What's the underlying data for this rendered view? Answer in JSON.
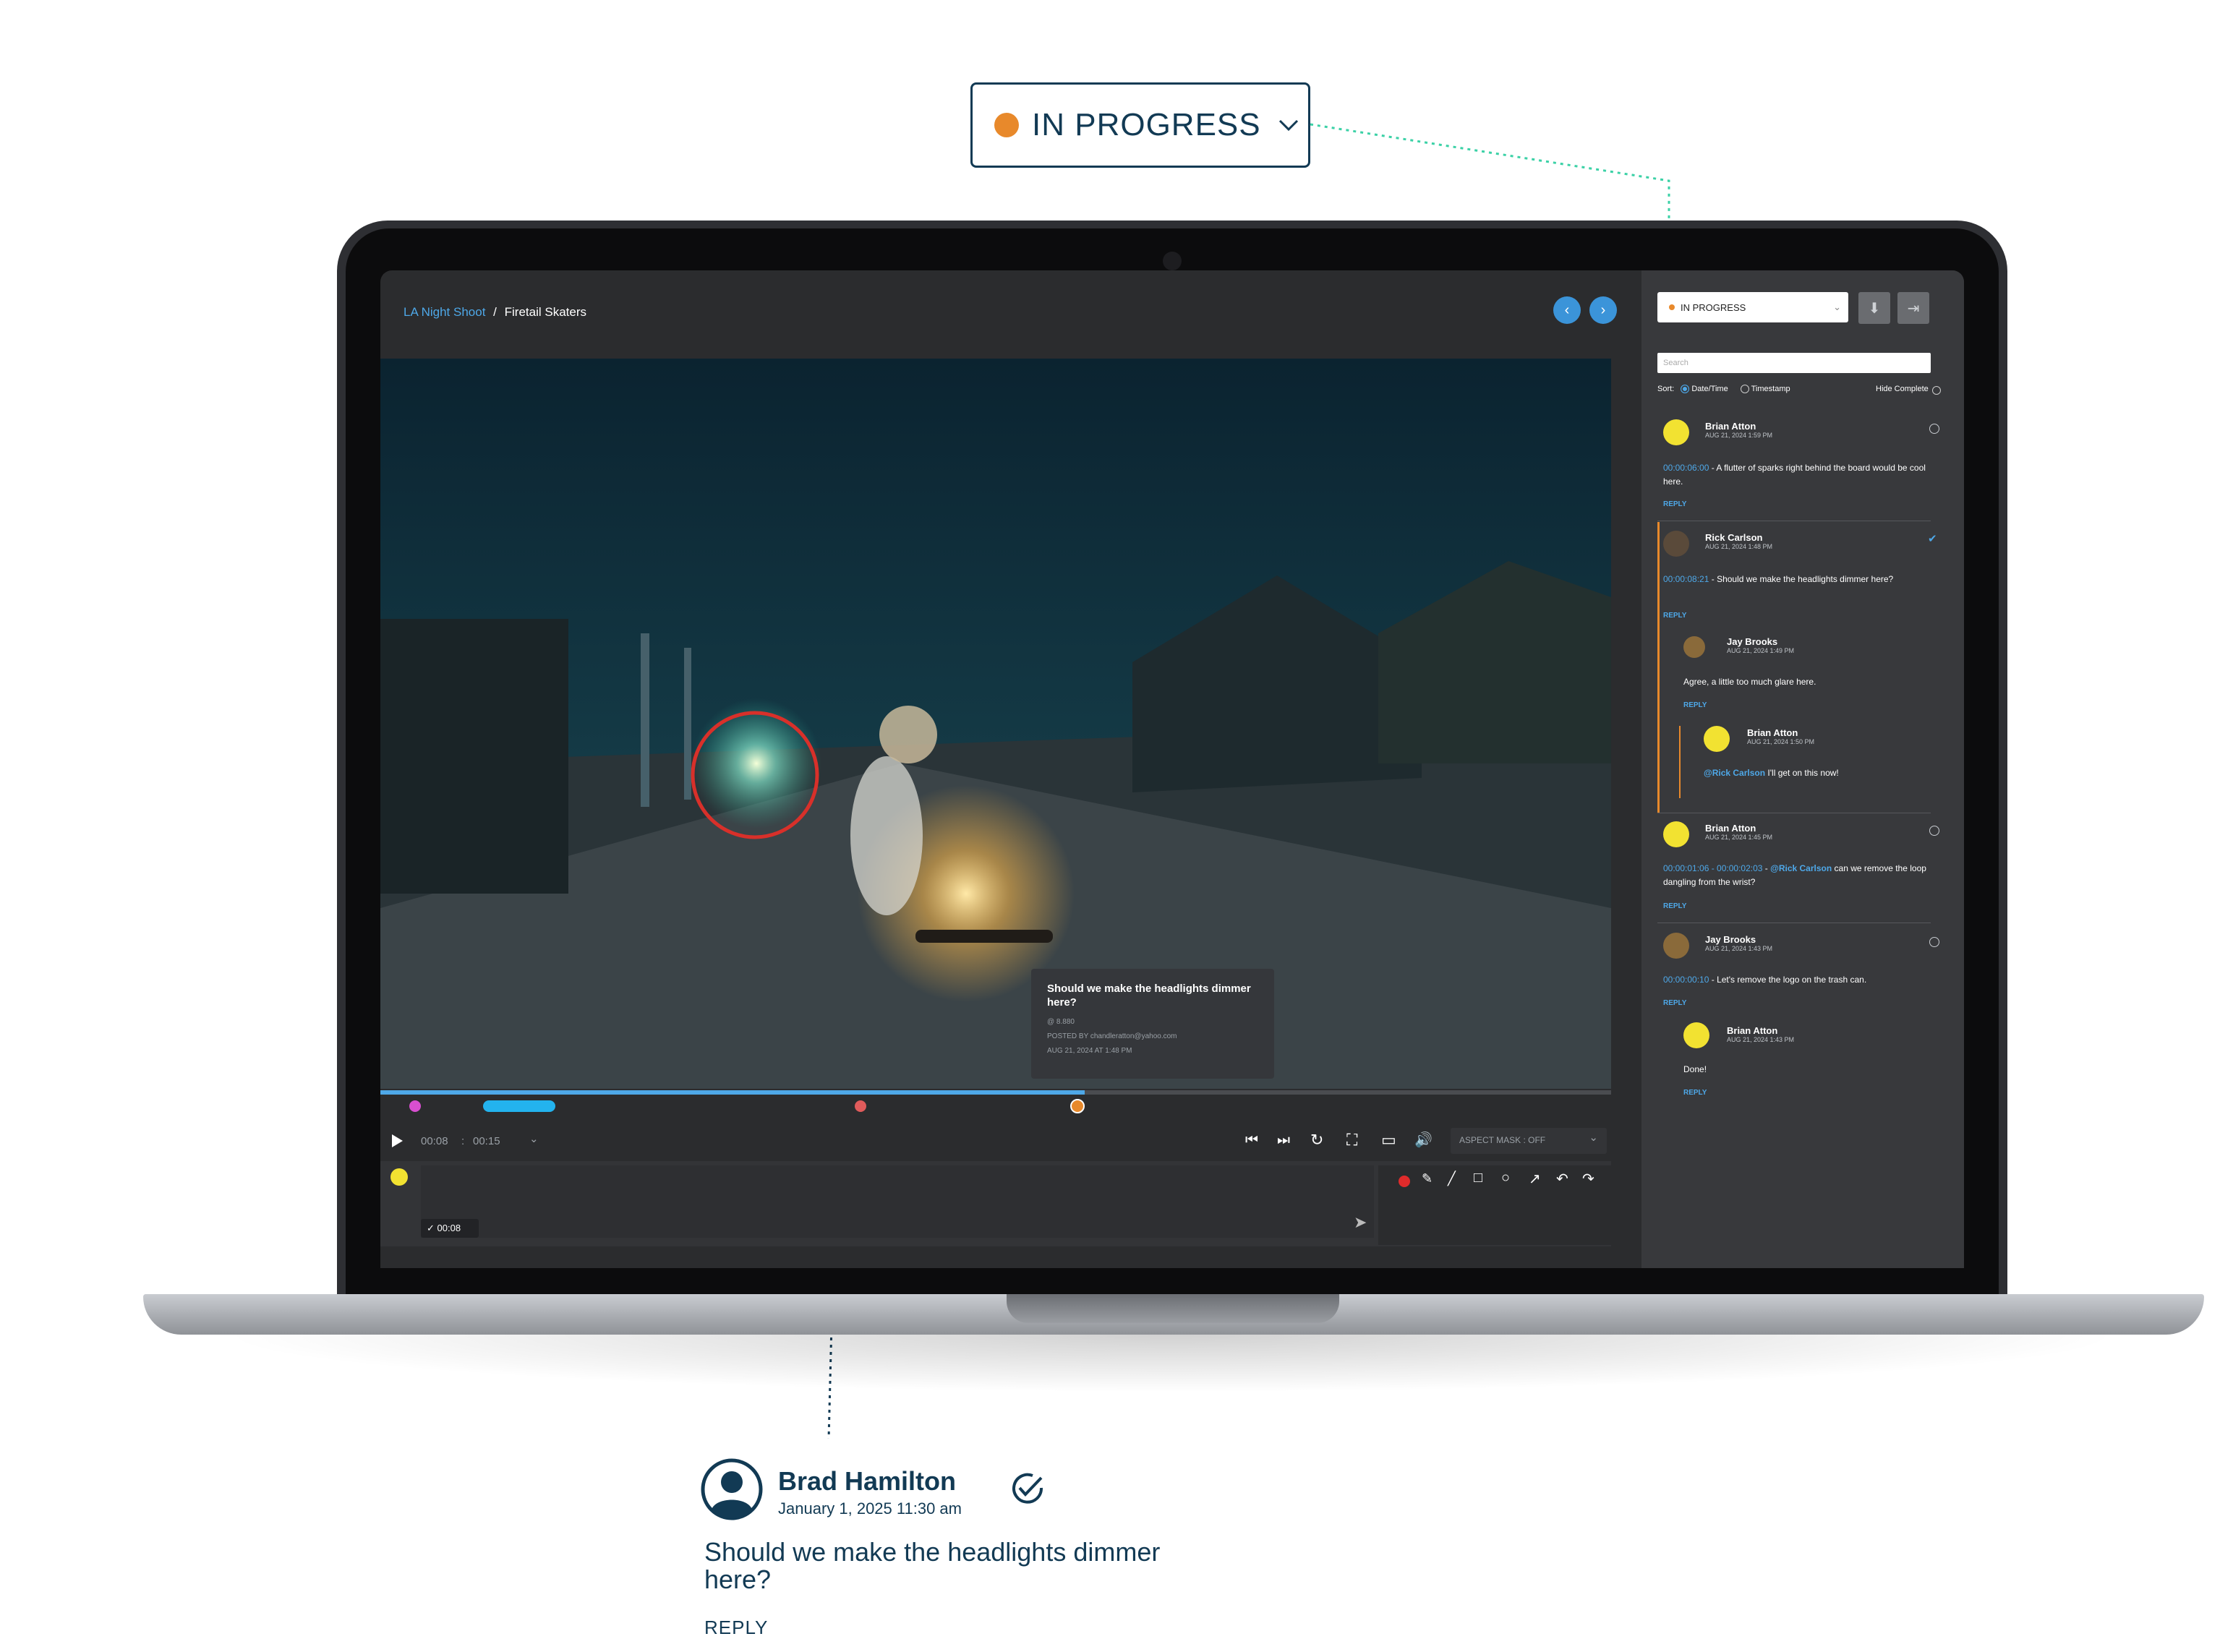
{
  "callout": {
    "status_label": "IN PROGRESS",
    "status_color": "#e8892b",
    "author_name": "Brad Hamilton",
    "author_date": "January 1, 2025 11:30 am",
    "comment_text": "Should we make the headlights dimmer here?",
    "reply_label": "REPLY",
    "check_icon": "circle-check-icon",
    "avatar_icon": "user-icon"
  },
  "app": {
    "breadcrumb": {
      "project": "LA Night Shoot",
      "separator": "/",
      "item": "Firetail Skaters"
    },
    "nav": {
      "prev_icon": "chevron-left-icon",
      "next_icon": "chevron-right-icon"
    },
    "player": {
      "current_time": "00:08",
      "separator": ":",
      "duration": "00:15",
      "aspect_mask": "ASPECT MASK : OFF",
      "progress_fraction": 0.572,
      "annotation_time": "00:08"
    },
    "tooltip": {
      "question": "Should we make the headlights dimmer here?",
      "frame": "@ 8.880",
      "posted_by": "POSTED BY chandleratton@yahoo.com",
      "date": "AUG 21, 2024 AT 1:48 PM"
    },
    "accent": "#4ea8e8",
    "sidebar": {
      "status": "IN PROGRESS",
      "search_placeholder": "Search",
      "sort_label": "Sort:",
      "sort_datetime": "Date/Time",
      "sort_timestamp": "Timestamp",
      "hide_complete": "Hide Complete",
      "reply": "REPLY",
      "comments": [
        {
          "name": "Brian Atton",
          "date": "AUG 21, 2024 1:59 PM",
          "timestamp": "00:00:06:00",
          "text": " - A flutter of sparks right behind the board would be cool here."
        },
        {
          "name": "Rick Carlson",
          "date": "AUG 21, 2024 1:48 PM",
          "timestamp": "00:00:08:21",
          "text": " - Should we make the headlights dimmer here?"
        },
        {
          "name": "Jay Brooks",
          "date": "AUG 21, 2024 1:49 PM",
          "text": "Agree, a little too much glare here."
        },
        {
          "name": "Brian Atton",
          "date": "AUG 21, 2024 1:50 PM",
          "mention": "@Rick Carlson",
          "text": " I'll get on this now!"
        },
        {
          "name": "Brian Atton",
          "date": "AUG 21, 2024 1:45 PM",
          "timestamp": "00:00:01:06 - 00:00:02:03",
          "mention": "@Rick Carlson",
          "text_a": " - ",
          "text": " can we remove the loop dangling from the wrist?"
        },
        {
          "name": "Jay Brooks",
          "date": "AUG 21, 2024 1:43 PM",
          "timestamp": "00:00:00:10",
          "text": " - Let's remove the logo on the trash can."
        },
        {
          "name": "Brian Atton",
          "date": "AUG 21, 2024 1:43 PM",
          "text": "Done!"
        }
      ]
    }
  }
}
